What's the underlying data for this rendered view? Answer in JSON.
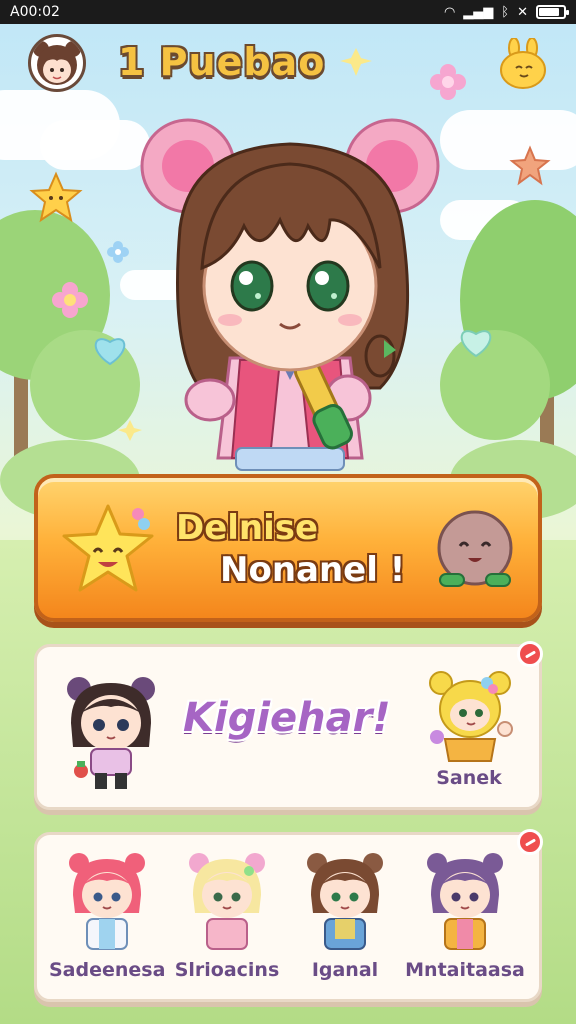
{
  "status_bar": {
    "time": "A00:02",
    "icons": [
      "wifi-icon",
      "signal-icon",
      "bluetooth-icon",
      "mute-icon",
      "battery-icon"
    ],
    "battery_level": 0.85
  },
  "header": {
    "title": "1 Puebao",
    "avatar_icon": "player-avatar",
    "mascot_icon": "yellow-bunny-mascot-icon"
  },
  "hero": {
    "character": "chibi-bear-ear-girl"
  },
  "banner": {
    "line1": "Delnise",
    "line2": "Nonanel !",
    "left_icon": "smiling-star-icon",
    "right_icon": "mochi-character-icon"
  },
  "card1": {
    "title": "Kigiehar!",
    "left_character": "dark-haired-bear-girl",
    "right_character": {
      "name": "Sanek"
    }
  },
  "card2": {
    "characters": [
      {
        "name": "Sadeenesa"
      },
      {
        "name": "Slrioacins"
      },
      {
        "name": "Iganal"
      },
      {
        "name": "Mntaitaasa"
      }
    ]
  },
  "colors": {
    "banner_orange": "#f4861c",
    "title_gold": "#f5c242",
    "card_title_purple": "#a665c4",
    "badge_red": "#ef4e4e"
  }
}
